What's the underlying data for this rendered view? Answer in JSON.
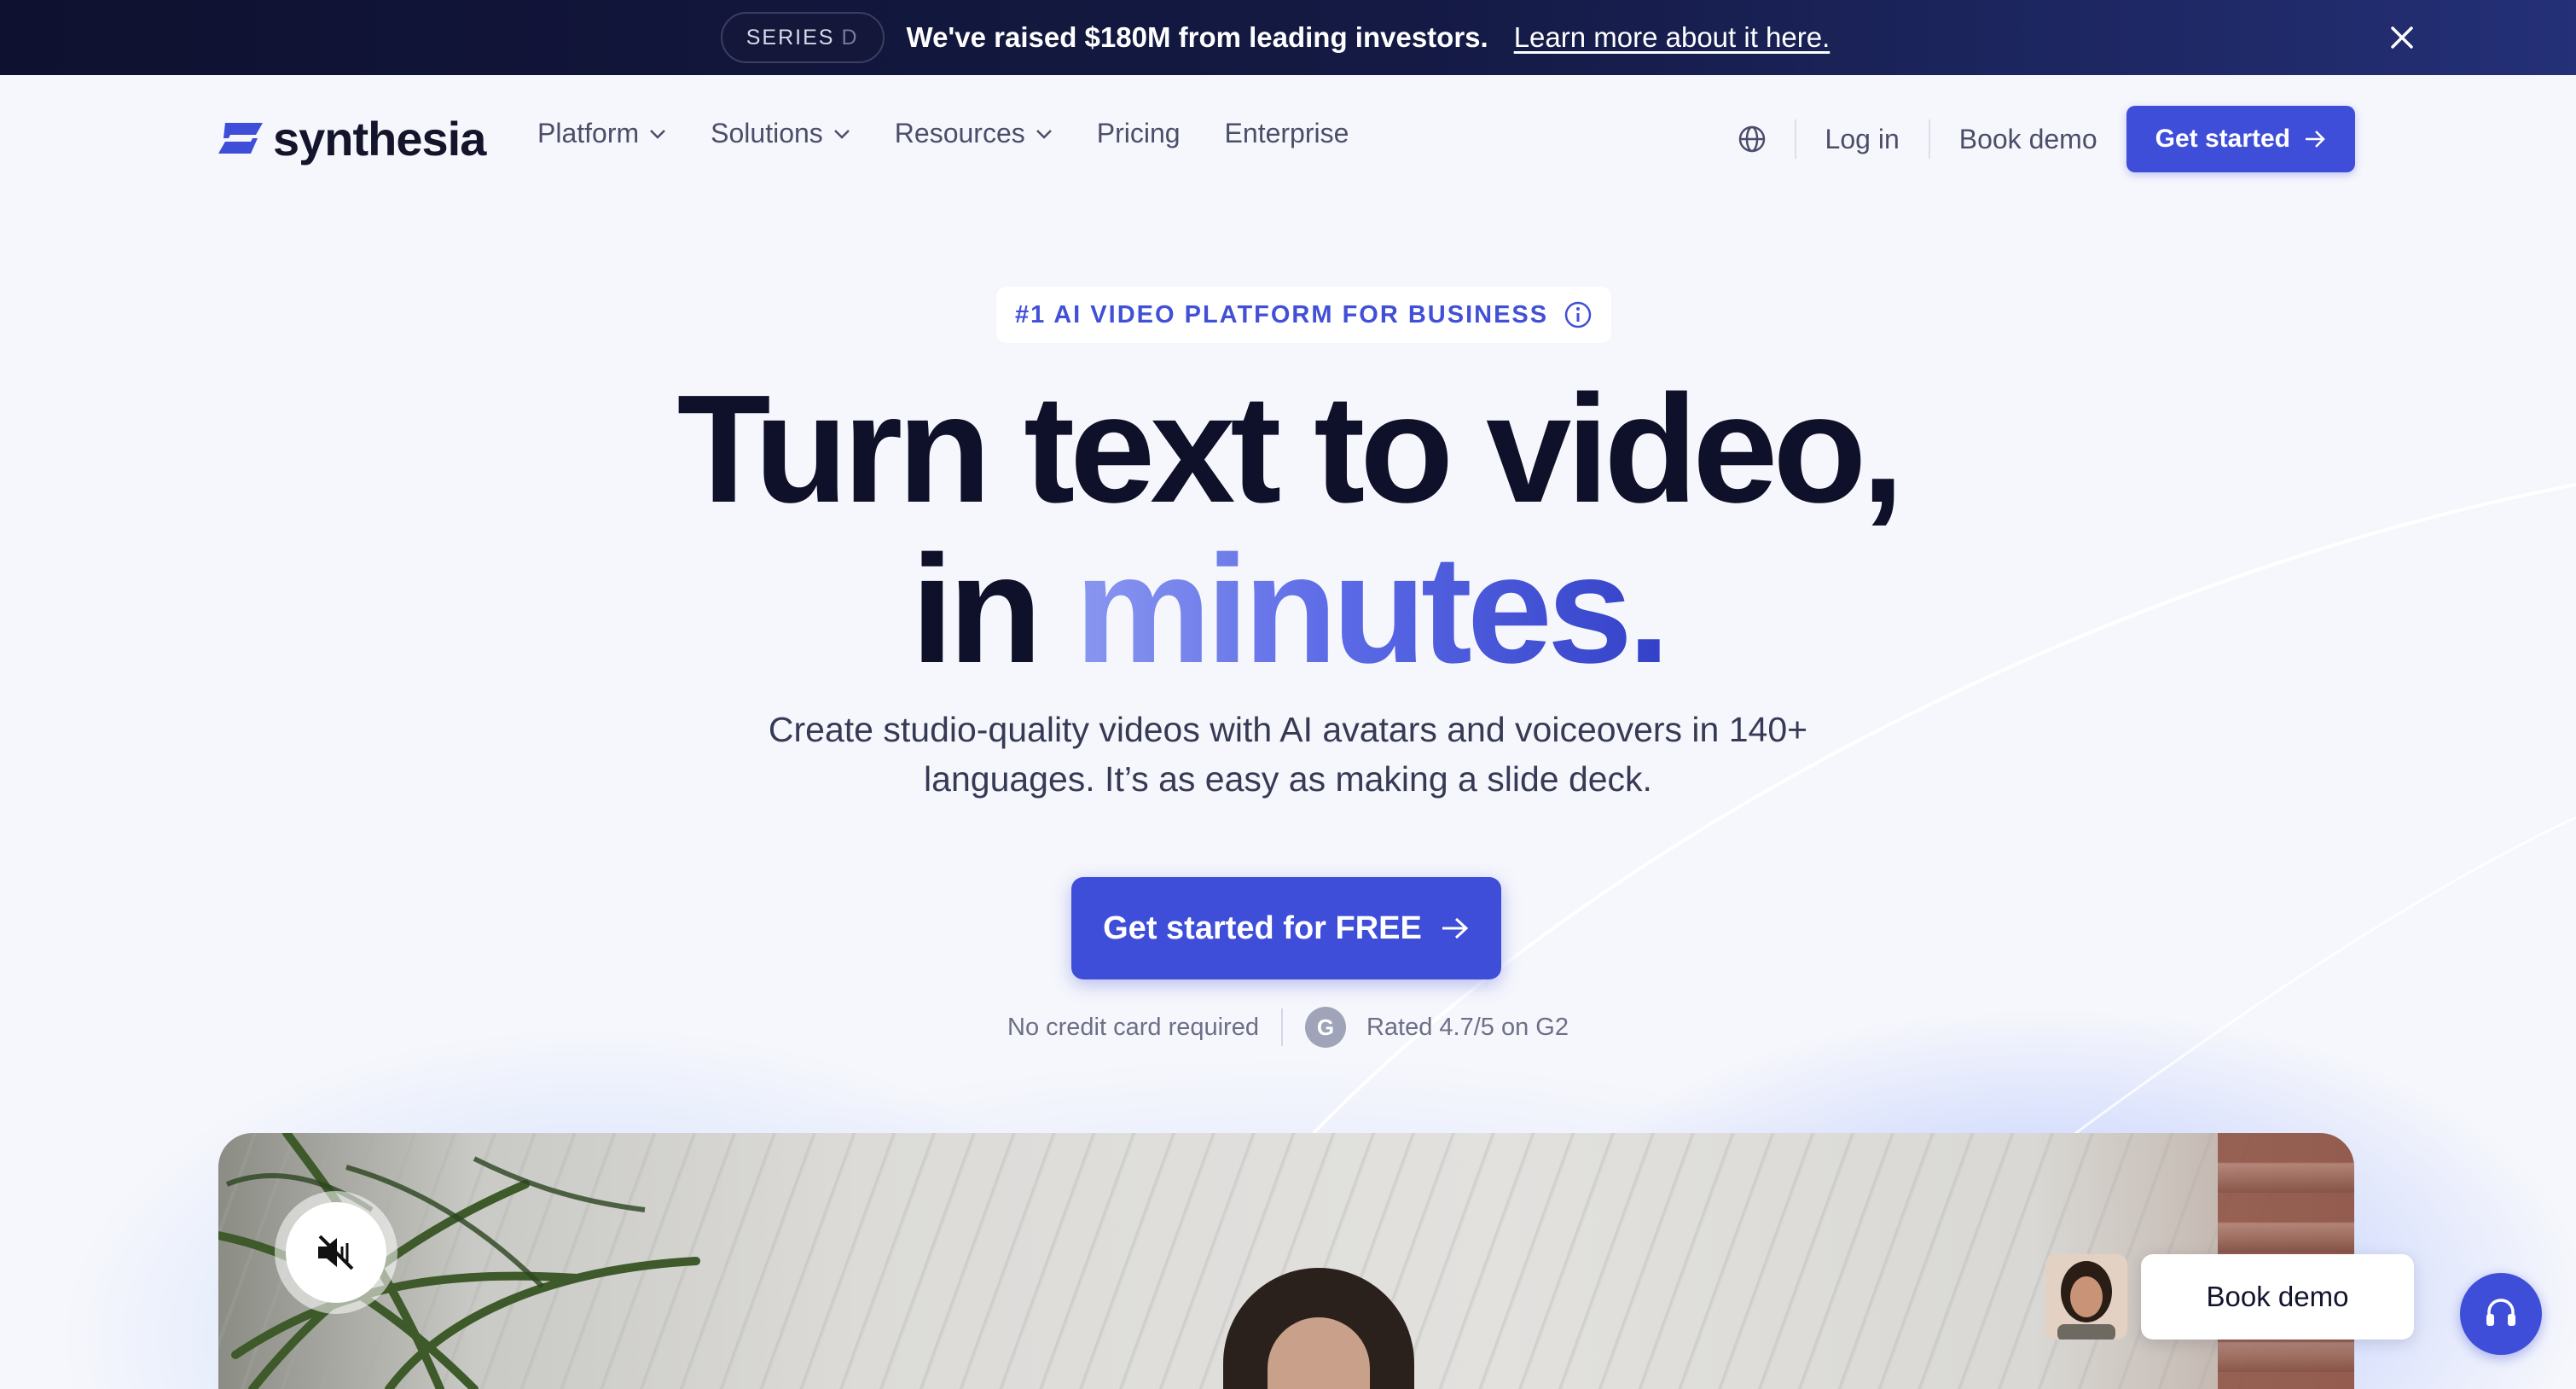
{
  "announcement": {
    "badge_main": "SERIES",
    "badge_dim": "D",
    "text": "We've raised $180M from leading investors.",
    "link": "Learn more about it here.",
    "close_icon": "close-icon"
  },
  "nav": {
    "logo_text": "synthesia",
    "links": [
      {
        "label": "Platform",
        "has_dropdown": true
      },
      {
        "label": "Solutions",
        "has_dropdown": true
      },
      {
        "label": "Resources",
        "has_dropdown": true
      },
      {
        "label": "Pricing",
        "has_dropdown": false
      },
      {
        "label": "Enterprise",
        "has_dropdown": false
      }
    ],
    "login": "Log in",
    "book_demo": "Book demo",
    "get_started": "Get started"
  },
  "hero": {
    "eyebrow": "#1 AI VIDEO PLATFORM FOR BUSINESS",
    "headline_line1": "Turn text to video,",
    "headline_line2_plain": "in ",
    "headline_line2_accent": "minutes.",
    "subhead_line1": "Create studio-quality videos with AI avatars and voiceovers in 140+",
    "subhead_line2": "languages. It’s as easy as making a slide deck.",
    "cta": "Get started for FREE",
    "trust_left": "No credit card required",
    "g2_badge": "G",
    "trust_right": "Rated 4.7/5 on G2"
  },
  "widgets": {
    "book_demo": "Book demo"
  },
  "colors": {
    "primary": "#3f4ed8",
    "announcement_bg": "#0f1130",
    "headline": "#0f1029",
    "accent_gradient_start": "#8a97f0",
    "accent_gradient_end": "#3341c8"
  }
}
